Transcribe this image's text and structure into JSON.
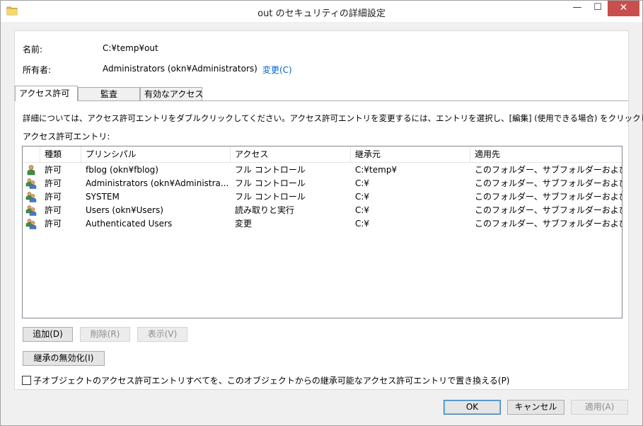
{
  "window": {
    "title": "out のセキュリティの詳細設定",
    "minimize_glyph": "—",
    "maximize_glyph": "☐",
    "close_glyph": "✕"
  },
  "info": {
    "name_label": "名前:",
    "name_value": "C:¥temp¥out",
    "owner_label": "所有者:",
    "owner_value": "Administrators (okn¥Administrators)",
    "change_link": "変更(C)"
  },
  "tabs": [
    {
      "label": "アクセス許可",
      "active": true
    },
    {
      "label": "監査",
      "active": false
    },
    {
      "label": "有効なアクセス",
      "active": false
    }
  ],
  "description": "詳細については、アクセス許可エントリをダブルクリックしてください。アクセス許可エントリを変更するには、エントリを選択し、[編集] (使用できる場合) をクリックします。",
  "entries_label": "アクセス許可エントリ:",
  "columns": {
    "type": "種類",
    "principal": "プリンシパル",
    "access": "アクセス",
    "inherited_from": "継承元",
    "applies_to": "適用先"
  },
  "rows": [
    {
      "icon": "user-icon",
      "type": "許可",
      "principal": "fblog (okn¥fblog)",
      "access": "フル コントロール",
      "inherited_from": "C:¥temp¥",
      "applies_to": "このフォルダー、サブフォルダーおよびファイル"
    },
    {
      "icon": "group-icon",
      "type": "許可",
      "principal": "Administrators (okn¥Administra...",
      "access": "フル コントロール",
      "inherited_from": "C:¥",
      "applies_to": "このフォルダー、サブフォルダーおよびファイル"
    },
    {
      "icon": "group-icon",
      "type": "許可",
      "principal": "SYSTEM",
      "access": "フル コントロール",
      "inherited_from": "C:¥",
      "applies_to": "このフォルダー、サブフォルダーおよびファイル"
    },
    {
      "icon": "group-icon",
      "type": "許可",
      "principal": "Users (okn¥Users)",
      "access": "読み取りと実行",
      "inherited_from": "C:¥",
      "applies_to": "このフォルダー、サブフォルダーおよびファイル"
    },
    {
      "icon": "group-icon",
      "type": "許可",
      "principal": "Authenticated Users",
      "access": "変更",
      "inherited_from": "C:¥",
      "applies_to": "このフォルダー、サブフォルダーおよびファイル"
    }
  ],
  "buttons": {
    "add": "追加(D)",
    "remove": "削除(R)",
    "view": "表示(V)",
    "disable_inheritance": "継承の無効化(I)",
    "ok": "OK",
    "cancel": "キャンセル",
    "apply": "適用(A)"
  },
  "replace_checkbox": {
    "label": "子オブジェクトのアクセス許可エントリすべてを、このオブジェクトからの継承可能なアクセス許可エントリで置き換える(P)",
    "checked": false
  }
}
